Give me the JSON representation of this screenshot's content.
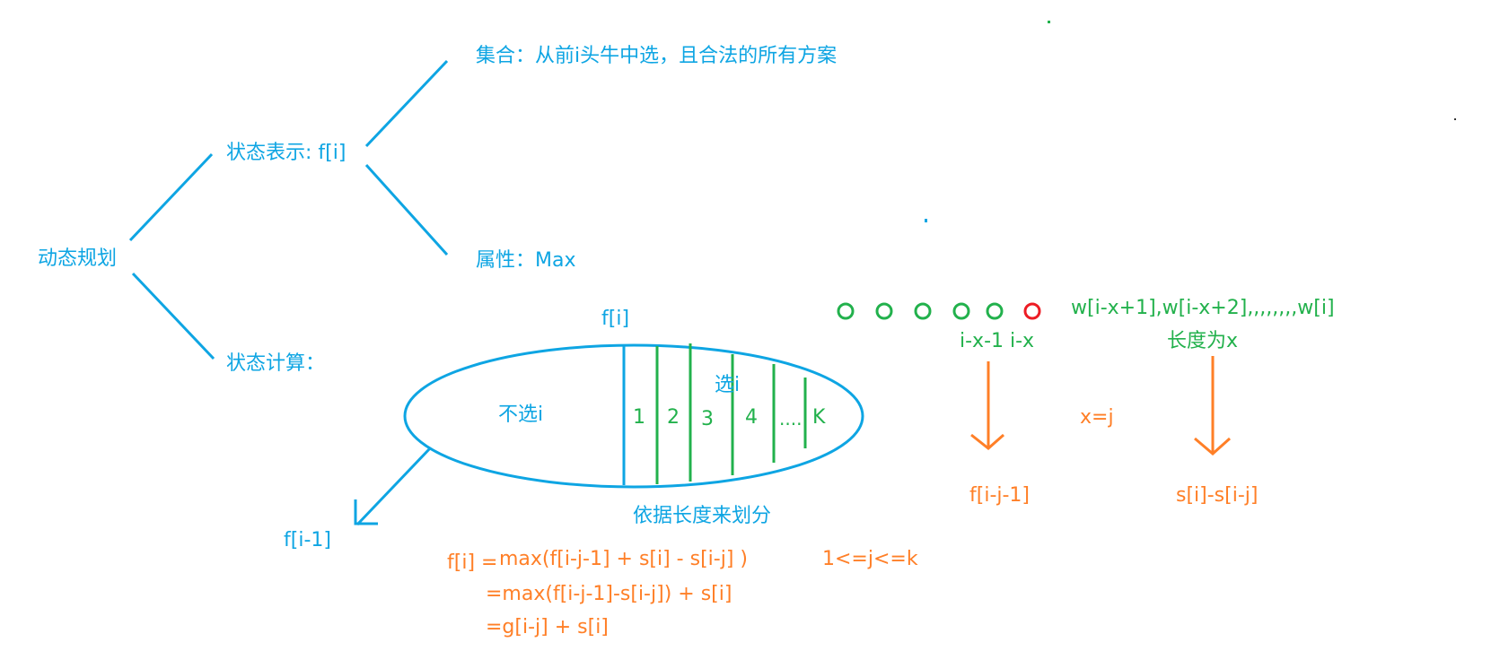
{
  "colors": {
    "blue": "#0ea5e3",
    "green": "#22b14c",
    "orange": "#ff7f27",
    "red": "#ed1c24"
  },
  "tree": {
    "root": "动态规划",
    "state_repr": "状态表示: f[i]",
    "set": "集合：从前i头牛中选，且合法的所有方案",
    "attribute": "属性：Max",
    "state_calc": "状态计算："
  },
  "ellipse": {
    "title": "f[i]",
    "not_choose": "不选i",
    "choose": "选i",
    "segments": [
      "1",
      "2",
      "3",
      "4",
      "....",
      "K"
    ],
    "caption": "依据长度来划分",
    "left_result": "f[i-1]"
  },
  "sequence": {
    "circles": [
      "green",
      "green",
      "green",
      "green",
      "green",
      "red"
    ],
    "range_text": "w[i-x+1],w[i-x+2],,,,,,,,w[i]",
    "length_text": "长度为x",
    "index_labels": "i-x-1 i-x",
    "x_eq_j": "x=j",
    "left_result": "f[i-j-1]",
    "right_result": "s[i]-s[i-j]"
  },
  "formula": {
    "lhs": "f[i] =",
    "line1": "max(f[i-j-1] + s[i]  - s[i-j] )",
    "constraint": "1<=j<=k",
    "line2": "=max(f[i-j-1]-s[i-j]) + s[i]",
    "line3": "=g[i-j] + s[i]"
  }
}
